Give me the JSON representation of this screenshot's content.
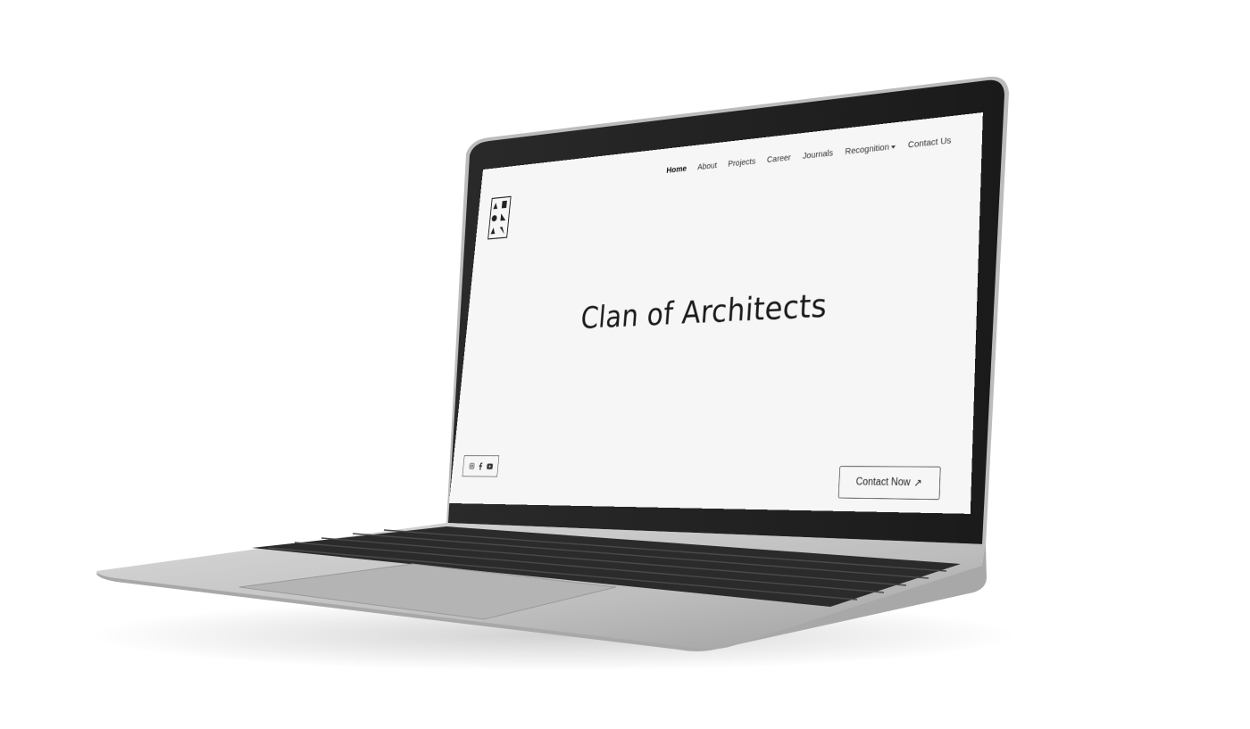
{
  "nav": {
    "items": [
      {
        "label": "Home",
        "active": true
      },
      {
        "label": "About",
        "active": false
      },
      {
        "label": "Projects",
        "active": false
      },
      {
        "label": "Career",
        "active": false
      },
      {
        "label": "Journals",
        "active": false
      },
      {
        "label": "Recognition",
        "active": false,
        "has_dropdown": true
      },
      {
        "label": "Contact Us",
        "active": false
      }
    ]
  },
  "hero": {
    "title": "Clan of Architects"
  },
  "social": {
    "icons": [
      "instagram-icon",
      "facebook-icon",
      "youtube-icon"
    ]
  },
  "cta": {
    "label": "Contact Now",
    "arrow": "↗"
  },
  "colors": {
    "screen_bg": "#f6f6f6",
    "text": "#1a1a1a",
    "bezel": "#1e1e1e",
    "laptop_body": "#c9c9c9"
  }
}
